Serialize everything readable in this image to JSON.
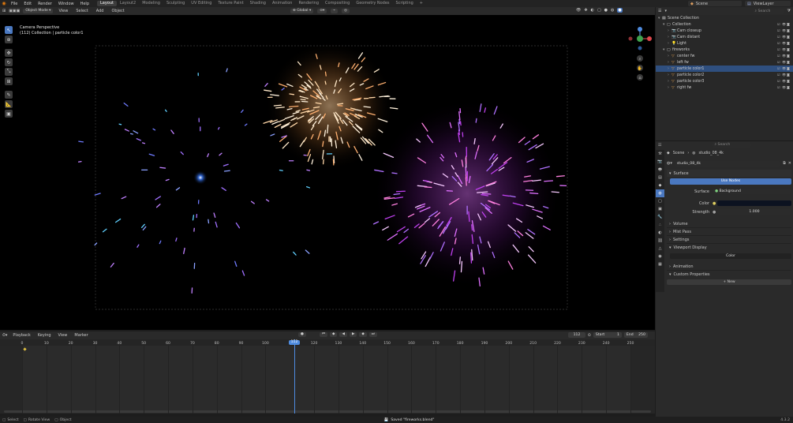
{
  "menubar": {
    "items": [
      "File",
      "Edit",
      "Render",
      "Window",
      "Help"
    ],
    "workspaces": [
      "Layout",
      "Layout2",
      "Modeling",
      "Sculpting",
      "UV Editing",
      "Texture Paint",
      "Shading",
      "Animation",
      "Rendering",
      "Compositing",
      "Geometry Nodes",
      "Scripting"
    ],
    "active_workspace": "Layout",
    "add_tab": "+",
    "scene_name": "Scene",
    "view_layer": "ViewLayer"
  },
  "viewport": {
    "mode": "Object Mode",
    "menus": [
      "View",
      "Select",
      "Add",
      "Object"
    ],
    "transform": "Global",
    "options_label": "Options",
    "overlay_title": "Camera Perspective",
    "overlay_subtitle": "(112) Collection | particle color1",
    "tools": [
      "cursor-tool",
      "move-tool",
      "rotate-tool",
      "scale-tool",
      "transform-tool",
      "annotate-tool",
      "measure-tool",
      "add-cube-tool"
    ]
  },
  "outliner": {
    "search_placeholder": "Search",
    "items": [
      {
        "label": "Scene Collection",
        "indent": 0,
        "icon": "scene-collection-icon",
        "sel": false
      },
      {
        "label": "Collection",
        "indent": 1,
        "icon": "collection-icon",
        "sel": false
      },
      {
        "label": "Cam closeup",
        "indent": 2,
        "icon": "camera-icon",
        "sel": false
      },
      {
        "label": "Cam distant",
        "indent": 2,
        "icon": "camera-icon",
        "sel": false
      },
      {
        "label": "Light",
        "indent": 2,
        "icon": "light-icon",
        "sel": false
      },
      {
        "label": "fireworks",
        "indent": 1,
        "icon": "collection-icon",
        "sel": false
      },
      {
        "label": "center fw",
        "indent": 2,
        "icon": "object-icon",
        "sel": false
      },
      {
        "label": "left fw",
        "indent": 2,
        "icon": "object-icon",
        "sel": false
      },
      {
        "label": "particle color1",
        "indent": 2,
        "icon": "object-icon",
        "sel": true
      },
      {
        "label": "particle color2",
        "indent": 2,
        "icon": "object-icon",
        "sel": false
      },
      {
        "label": "particle color3",
        "indent": 2,
        "icon": "object-icon",
        "sel": false
      },
      {
        "label": "right fw",
        "indent": 2,
        "icon": "object-icon",
        "sel": false
      }
    ]
  },
  "properties": {
    "search_placeholder": "Search",
    "breadcrumb_scene": "Scene",
    "breadcrumb_world": "studio_08_4k",
    "world_name": "studio_08_4k",
    "surface_panel": "Surface",
    "use_nodes": "Use Nodes",
    "surface_label": "Surface",
    "surface_value": "Background",
    "color_label": "Color",
    "strength_label": "Strength",
    "strength_value": "1.000",
    "panels": [
      "Volume",
      "Mist Pass",
      "Settings"
    ],
    "viewport_display": "Viewport Display",
    "vd_color": "Color",
    "panels2": [
      "Animation",
      "Custom Properties"
    ],
    "new_label": "New"
  },
  "timeline": {
    "menus": [
      "Playback",
      "Keying",
      "View",
      "Marker"
    ],
    "current_frame": "112",
    "start_label": "Start",
    "start_value": "1",
    "end_label": "End",
    "end_value": "250",
    "ticks": [
      "0",
      "10",
      "20",
      "30",
      "40",
      "50",
      "60",
      "70",
      "80",
      "90",
      "100",
      "112",
      "120",
      "130",
      "140",
      "150",
      "160",
      "170",
      "180",
      "190",
      "200",
      "210",
      "220",
      "230",
      "240",
      "250"
    ],
    "playhead": "112"
  },
  "statusbar": {
    "select": "Select",
    "rotate_view": "Rotate View",
    "object": "Object",
    "message": "Saved \"fireworks.blend\"",
    "version": "4.3.2"
  },
  "colors": {
    "accent": "#4a78c0",
    "selected_row": "#2f4f7f",
    "bg": "#1d1d1d",
    "playhead": "#4f8ce0"
  }
}
